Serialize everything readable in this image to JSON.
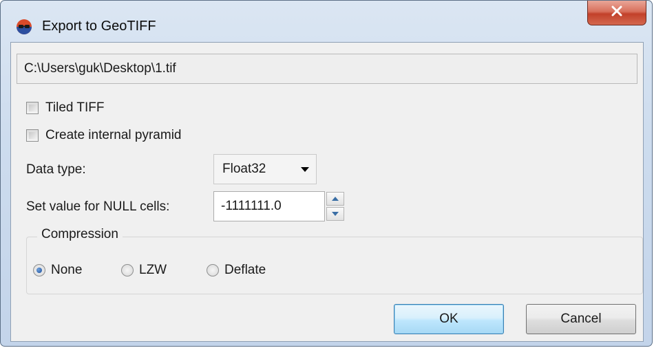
{
  "window": {
    "title": "Export to GeoTIFF",
    "close_label": "x"
  },
  "path": {
    "value": "C:\\Users\\guk\\Desktop\\1.tif"
  },
  "options": {
    "tiled_tiff": {
      "label": "Tiled TIFF",
      "checked": false
    },
    "internal_pyramid": {
      "label": "Create internal pyramid",
      "checked": false
    }
  },
  "data_type": {
    "label": "Data type:",
    "selected": "Float32"
  },
  "null_value": {
    "label": "Set value for NULL cells:",
    "value": "-1111111.0"
  },
  "compression": {
    "title": "Compression",
    "options": [
      {
        "label": "None",
        "checked": true
      },
      {
        "label": "LZW",
        "checked": false
      },
      {
        "label": "Deflate",
        "checked": false
      }
    ]
  },
  "buttons": {
    "ok": "OK",
    "cancel": "Cancel"
  },
  "colors": {
    "title_bar": "#cddcee",
    "close_button": "#c2412a",
    "dialog_bg": "#f0f0f0",
    "default_button": "#bee6fd"
  }
}
